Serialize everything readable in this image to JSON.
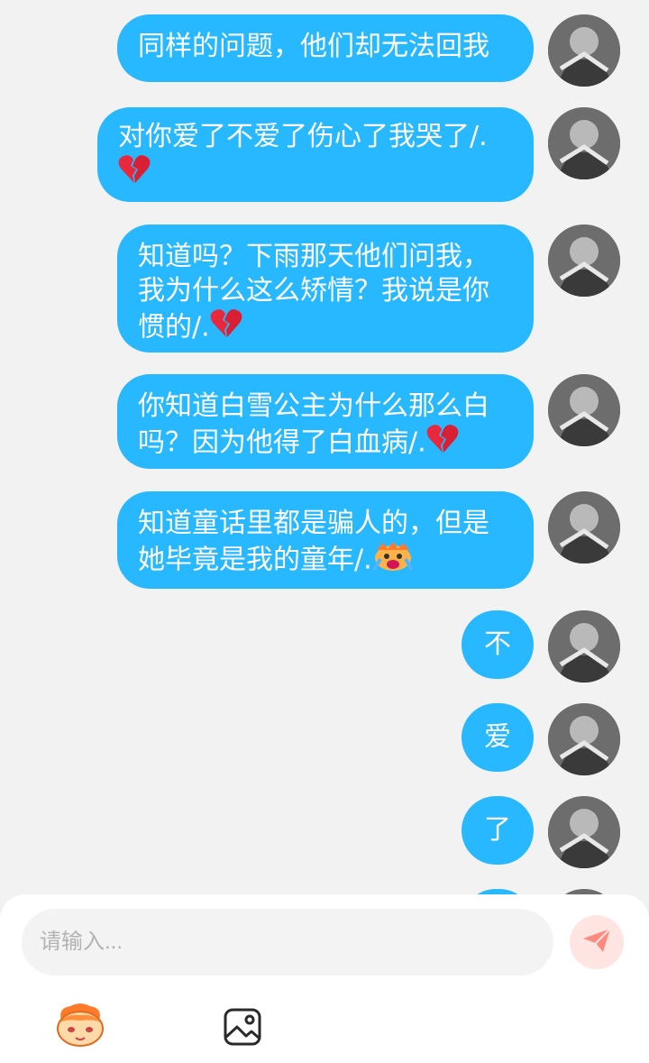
{
  "messages": [
    {
      "text": "同样的问题，他们却无法回我",
      "emoji": ""
    },
    {
      "text": "对你爱了不爱了伤心了我哭了/.",
      "emoji": "broken-heart"
    },
    {
      "text": "知道吗？下雨那天他们问我，我为什么这么矫情？我说是你惯的/.",
      "emoji": "broken-heart"
    },
    {
      "text": "你知道白雪公主为什么那么白吗？因为他得了白血病/.",
      "emoji": "broken-heart"
    },
    {
      "text": "知道童话里都是骗人的，但是她毕竟是我的童年/.",
      "emoji": "crying-cartoon"
    },
    {
      "text": "不",
      "emoji": ""
    },
    {
      "text": "爱",
      "emoji": ""
    },
    {
      "text": "了",
      "emoji": ""
    }
  ],
  "composer": {
    "placeholder": "请输入...",
    "send_icon": "paper-plane-icon",
    "tools": [
      "emoji-mascot-icon",
      "image-icon"
    ]
  },
  "colors": {
    "bubble": "#27b8ff",
    "background": "#f2f2f2",
    "send_button": "#ffe5e2",
    "send_arrow": "#ff8a80"
  }
}
